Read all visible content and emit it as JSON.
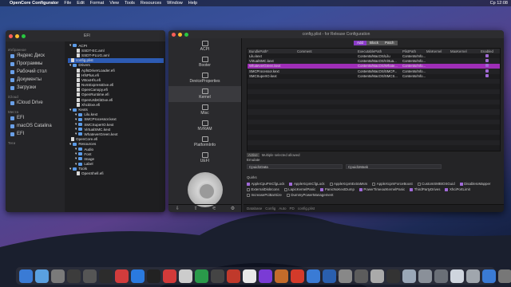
{
  "menubar": {
    "apple": "",
    "app": "OpenCore Configurator",
    "items": [
      "File",
      "Edit",
      "Format",
      "View",
      "Tools",
      "Resources",
      "Window",
      "Help"
    ],
    "clock": "Ср 12:08"
  },
  "finder": {
    "path": "EFI",
    "sidebar": [
      {
        "section": "Избранное",
        "items": [
          "Яндекс Диск",
          "Программы",
          "Рабочий стол",
          "Документы",
          "Загрузки"
        ]
      },
      {
        "section": "iCloud",
        "items": [
          "iCloud Drive"
        ]
      },
      {
        "section": "Места",
        "items": [
          "EFI",
          "macOS Catalina",
          "EFI"
        ]
      },
      {
        "section": "Теги",
        "items": []
      }
    ],
    "rows": [
      {
        "name": "ACPI",
        "type": "folder",
        "indent": 0
      },
      {
        "name": "SSDT-EC.aml",
        "type": "file",
        "indent": 1
      },
      {
        "name": "SSDT-PLUG.aml",
        "type": "file",
        "indent": 1
      },
      {
        "name": "config.plist",
        "type": "file",
        "indent": 0,
        "selected": true
      },
      {
        "name": "Drivers",
        "type": "folder",
        "indent": 0
      },
      {
        "name": "ApfsDriverLoader.efi",
        "type": "file",
        "indent": 1
      },
      {
        "name": "HfsPlus.efi",
        "type": "file",
        "indent": 1
      },
      {
        "name": "VBoxHfs.efi",
        "type": "file",
        "indent": 1
      },
      {
        "name": "NvmExpressDxe.efi",
        "type": "file",
        "indent": 1
      },
      {
        "name": "OpenCanopy.efi",
        "type": "file",
        "indent": 1
      },
      {
        "name": "OpenRuntime.efi",
        "type": "file",
        "indent": 1
      },
      {
        "name": "OpenUsbKbDxe.efi",
        "type": "file",
        "indent": 1
      },
      {
        "name": "XhciDxe.efi",
        "type": "file",
        "indent": 1
      },
      {
        "name": "Kexts",
        "type": "folder",
        "indent": 0
      },
      {
        "name": "Lilu.kext",
        "type": "folder",
        "indent": 1
      },
      {
        "name": "SMCProcessor.kext",
        "type": "folder",
        "indent": 1
      },
      {
        "name": "SMCSuperIO.kext",
        "type": "folder",
        "indent": 1
      },
      {
        "name": "VirtualSMC.kext",
        "type": "folder",
        "indent": 1
      },
      {
        "name": "WhateverGreen.kext",
        "type": "folder",
        "indent": 1
      },
      {
        "name": "OpenCore.efi",
        "type": "file",
        "indent": 0
      },
      {
        "name": "Resources",
        "type": "folder",
        "indent": 0
      },
      {
        "name": "Audio",
        "type": "folder",
        "indent": 1
      },
      {
        "name": "Font",
        "type": "folder",
        "indent": 1
      },
      {
        "name": "Image",
        "type": "folder",
        "indent": 1
      },
      {
        "name": "Label",
        "type": "folder",
        "indent": 1
      },
      {
        "name": "Tools",
        "type": "folder",
        "indent": 0
      },
      {
        "name": "OpenShell.efi",
        "type": "file",
        "indent": 1
      }
    ]
  },
  "occ": {
    "title": "config.plist - for Release Configuration",
    "nav": [
      "ACPI",
      "Booter",
      "DeviceProperties",
      "Kernel",
      "Misc",
      "NVRAM",
      "PlatformInfo",
      "UEFI"
    ],
    "selectedNav": "Kernel",
    "tabs": [
      "Add",
      "Block",
      "Patch"
    ],
    "activeTab": "Add",
    "columns": [
      "BundlePath*",
      "Comment",
      "ExecutablePath",
      "PlistPath",
      "MinKernel",
      "MaxKernel",
      "Enabled"
    ],
    "rows": [
      {
        "c": [
          "Lilu.kext",
          "",
          "Contents/MacOS/Lilu",
          "Contents/Info...",
          "",
          "",
          ""
        ],
        "en": true
      },
      {
        "c": [
          "VirtualSMC.kext",
          "",
          "Contents/MacOS/Virtua...",
          "Contents/Info...",
          "",
          "",
          ""
        ],
        "en": true
      },
      {
        "c": [
          "WhateverGreen.kext",
          "",
          "Contents/MacOS/Whate...",
          "Contents/Info...",
          "",
          "",
          ""
        ],
        "en": true,
        "sel": true
      },
      {
        "c": [
          "SMCProcessor.kext",
          "",
          "Contents/MacOS/SMCP...",
          "Contents/Info...",
          "",
          "",
          ""
        ],
        "en": true
      },
      {
        "c": [
          "SMCSuperIO.kext",
          "",
          "Contents/MacOS/SMCS...",
          "Contents/Info...",
          "",
          "",
          ""
        ],
        "en": true
      }
    ],
    "tableFooter": {
      "button": "Active",
      "text": "Multiple selected allowed"
    },
    "emulate": {
      "title": "Emulate",
      "fields": [
        {
          "label": "Cpuid1Data",
          "value": ""
        },
        {
          "label": "Cpuid1Mask",
          "value": ""
        }
      ]
    },
    "quirks": {
      "title": "Quirks",
      "items": [
        {
          "label": "AppleCpuPmCfgLock",
          "on": true
        },
        {
          "label": "AppleXcpmCfgLock",
          "on": true
        },
        {
          "label": "AppleXcpmExtraMsrs",
          "on": false
        },
        {
          "label": "AppleXcpmForceBoost",
          "on": false
        },
        {
          "label": "CustomSMBIOSGuid",
          "on": false
        },
        {
          "label": "DisableIoMapper",
          "on": true
        },
        {
          "label": "ExternalDiskIcons",
          "on": false
        },
        {
          "label": "LapicKernelPanic",
          "on": false
        },
        {
          "label": "PanicNoKextDump",
          "on": true
        },
        {
          "label": "PowerTimeoutKernelPanic",
          "on": true
        },
        {
          "label": "ThirdPartyDrives",
          "on": true
        },
        {
          "label": "XhciPortLimit",
          "on": true
        },
        {
          "label": "IncreasePciBarSize",
          "on": false
        },
        {
          "label": "DummyPowerManagement",
          "on": false
        }
      ]
    },
    "status": [
      "Database",
      "Config",
      "Auto",
      "PD",
      "config.plist"
    ]
  },
  "dock": {
    "colors": [
      "#3a7bd5",
      "#5aa0e0",
      "#7a7a7a",
      "#3c3c3c",
      "#555555",
      "#2c2c2c",
      "#d23c3c",
      "#2a7adf",
      "#222222",
      "#d23a3a",
      "#cccccc",
      "#2a9a4a",
      "#444444",
      "#c0392b",
      "#e8e8e8",
      "#7a3bd5",
      "#c46b2a",
      "#d43a2a",
      "#3a7bd5",
      "#2a5fae",
      "#888888",
      "#5c5c5c",
      "#aaaaaa",
      "#333333",
      "#9aa7b8",
      "#8a9099",
      "#6a6f77",
      "#cfd5de",
      "#a0a6ad",
      "#3a7bd5",
      "#777777"
    ]
  }
}
